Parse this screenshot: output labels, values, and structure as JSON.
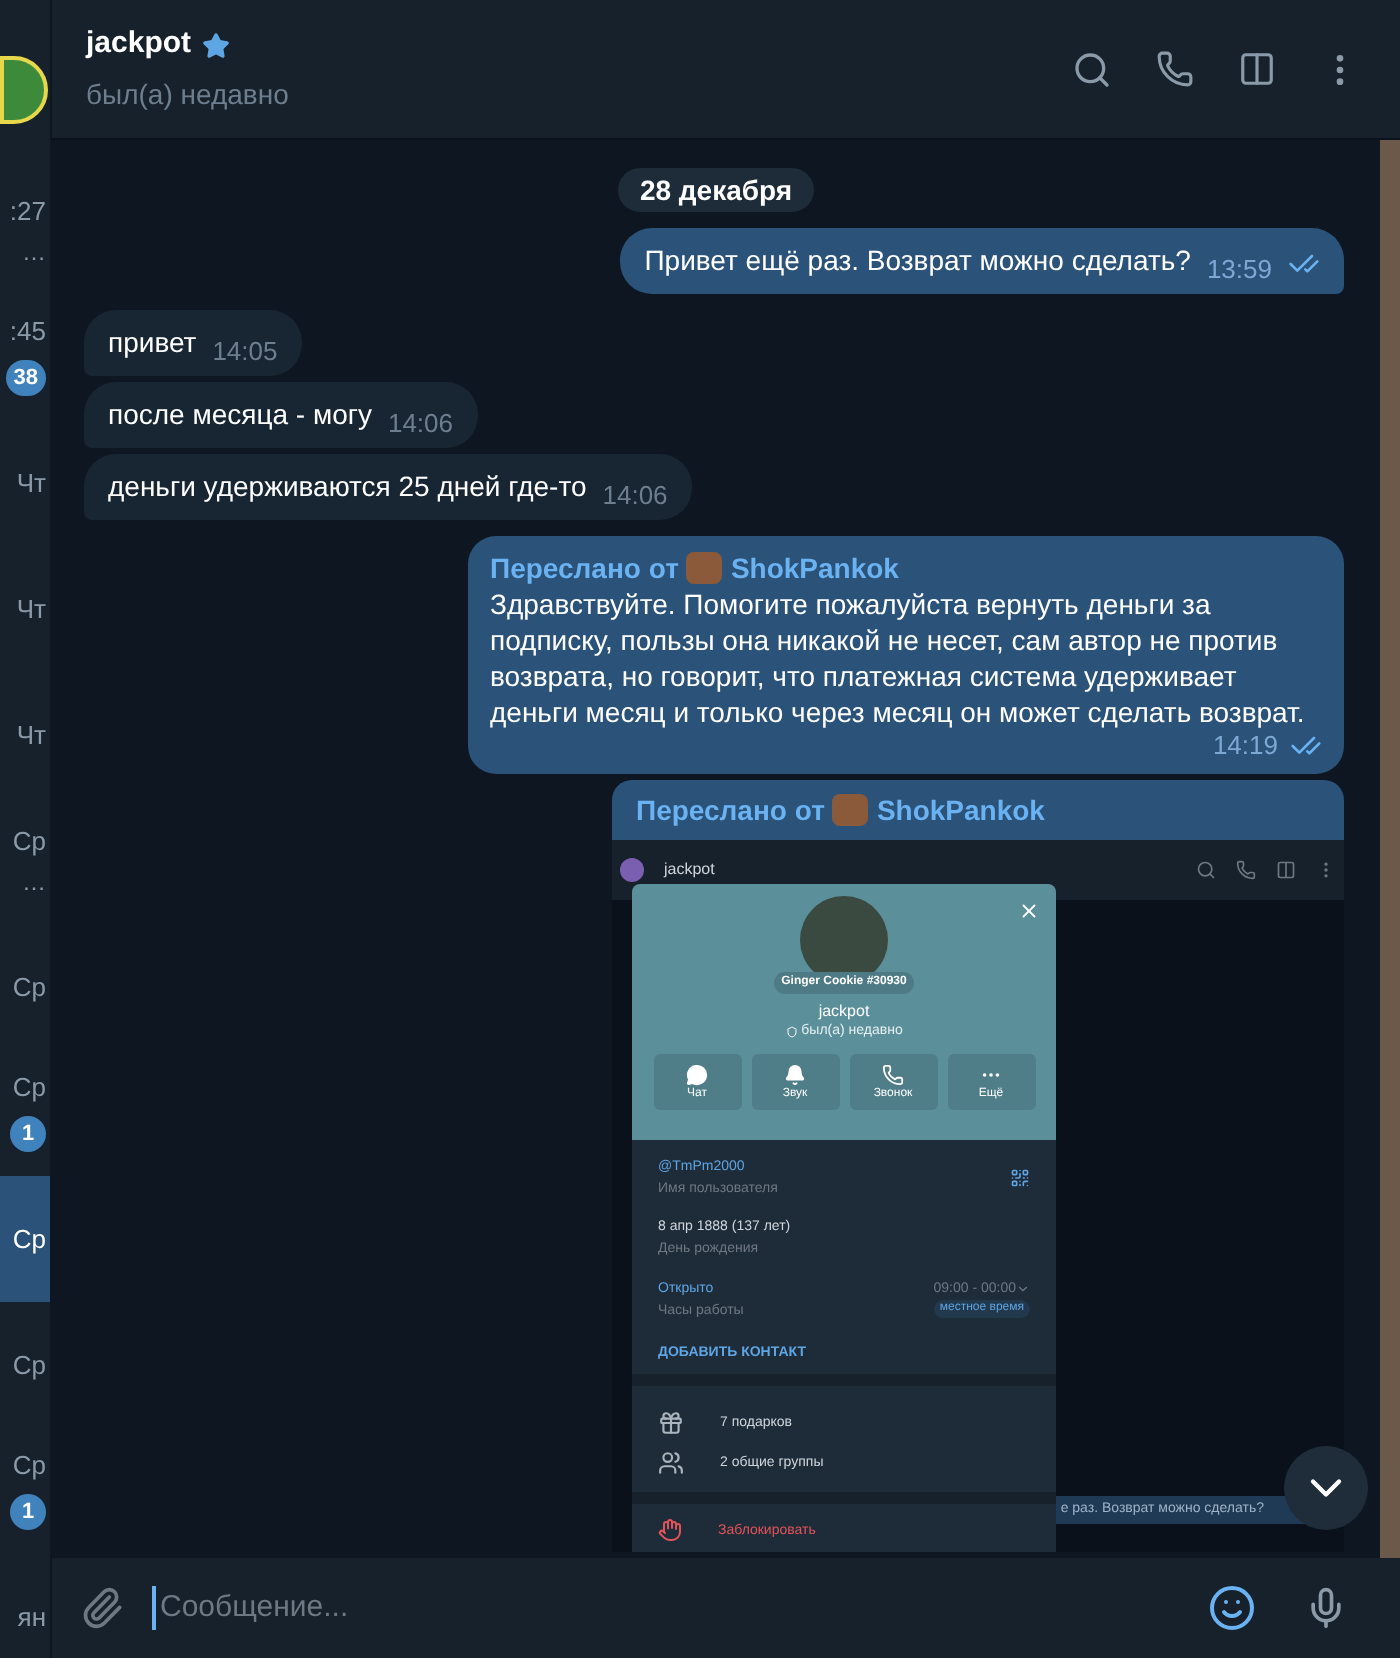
{
  "sidebar": {
    "chats": [
      {
        "kind": "avatar"
      },
      {
        "kind": "chat",
        "time": ":27",
        "preview": "…",
        "selected": false
      },
      {
        "kind": "chat",
        "time": ":45",
        "badge": "38",
        "selected": false
      },
      {
        "kind": "chat",
        "time": "Чт",
        "selected": false
      },
      {
        "kind": "chat",
        "time": "Чт",
        "selected": false
      },
      {
        "kind": "chat",
        "time": "Чт",
        "selected": false
      },
      {
        "kind": "chat",
        "time": "Ср",
        "preview": "…",
        "selected": false
      },
      {
        "kind": "chat",
        "time": "Ср",
        "selected": false
      },
      {
        "kind": "chat",
        "time": "Ср",
        "badge": "1",
        "selected": false
      },
      {
        "kind": "chat",
        "time": "Ср",
        "selected": true
      },
      {
        "kind": "chat",
        "time": "Ср",
        "selected": false
      },
      {
        "kind": "chat",
        "time": "Ср",
        "badge": "1",
        "selected": false
      },
      {
        "kind": "chat",
        "time": "ян",
        "selected": false
      }
    ]
  },
  "header": {
    "title": "jackpot",
    "verified": true,
    "status": "был(а) недавно"
  },
  "messages": [
    {
      "kind": "date",
      "text": "28 декабря"
    },
    {
      "kind": "text",
      "outgoing": true,
      "text": "Привет ещё раз. Возврат можно сделать?",
      "time": "13:59",
      "read": true
    },
    {
      "kind": "text",
      "outgoing": false,
      "text": "привет",
      "time": "14:05"
    },
    {
      "kind": "text",
      "outgoing": false,
      "text": "после месяца - могу",
      "time": "14:06"
    },
    {
      "kind": "text",
      "outgoing": false,
      "text": "деньги удерживаются 25 дней где-то",
      "time": "14:06"
    },
    {
      "kind": "forwarded_text",
      "outgoing": true,
      "forward_label": "Переслано от",
      "forward_from": "ShokPankok",
      "text": "Здравствуйте. Помогите пожалуйста вернуть деньги за подписку, пользы она никакой не несет, сам автор не против возврата, но говорит, что платежная система удерживает деньги месяц и только через месяц он может сделать возврат.",
      "time": "14:19",
      "read": true
    },
    {
      "kind": "forwarded_screenshot",
      "outgoing": true,
      "forward_label": "Переслано от",
      "forward_from": "ShokPankok",
      "screenshot": {
        "header_title": "jackpot",
        "gift_label": "Ginger Cookie #30930",
        "name": "jackpot",
        "status": "был(а) недавно",
        "actions": [
          {
            "kind": "chat",
            "label": "Чат"
          },
          {
            "kind": "sound",
            "label": "Звук"
          },
          {
            "kind": "call",
            "label": "Звонок"
          },
          {
            "kind": "more",
            "label": "Ещё"
          }
        ],
        "username": "@TmPm2000",
        "username_label": "Имя пользователя",
        "birthday": "8 апр 1888 (137 лет)",
        "birthday_label": "День рождения",
        "hours_status": "Открыто",
        "hours": "09:00 - 00:00",
        "hours_label": "Часы работы",
        "hours_badge": "местное время",
        "add_contact": "ДОБАВИТЬ КОНТАКТ",
        "rows": [
          {
            "kind": "gifts",
            "text": "7 подарков"
          },
          {
            "kind": "groups",
            "text": "2 общие группы"
          }
        ],
        "block": "Заблокировать",
        "background_message": "е раз. Возврат можно сделать?"
      }
    }
  ],
  "composer": {
    "placeholder": "Сообщение..."
  }
}
